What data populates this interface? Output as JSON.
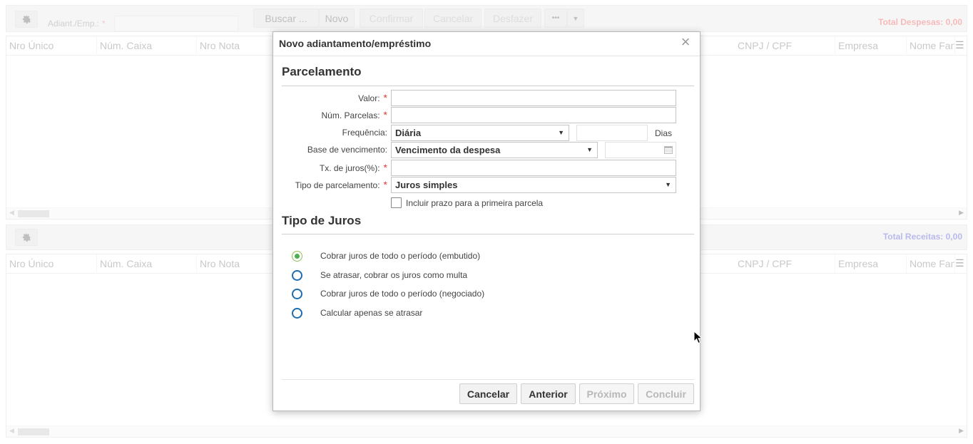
{
  "toolbar": {
    "field_label": "Adiant./Emp.:",
    "required_mark": "*",
    "buttons": {
      "buscar": "Buscar ...",
      "novo": "Novo",
      "confirmar": "Confirmar",
      "cancelar": "Cancelar",
      "desfazer": "Desfazer",
      "more": "•••"
    },
    "total_despesas": "Total Despesas: 0,00",
    "total_despesas_color": "#f08080"
  },
  "grid_columns": [
    "Nro Único",
    "Núm. Caixa",
    "Nro Nota",
    "CNPJ / CPF",
    "Empresa",
    "Nome Fant"
  ],
  "bar2": {
    "total_receitas": "Total Receitas: 0,00",
    "total_receitas_color": "#8080e0"
  },
  "modal": {
    "title": "Novo adiantamento/empréstimo",
    "section_parcelamento": "Parcelamento",
    "fields": {
      "valor": "Valor:",
      "num_parcelas": "Núm. Parcelas:",
      "frequencia": "Frequência:",
      "frequencia_value": "Diária",
      "dias_label": "Dias",
      "base_vencimento": "Base de vencimento:",
      "base_vencimento_value": "Vencimento da despesa",
      "tx_juros": "Tx. de juros(%):",
      "tipo_parcelamento": "Tipo de parcelamento:",
      "tipo_parcelamento_value": "Juros simples",
      "required_mark": "*"
    },
    "checkbox_label": "Incluir prazo para a primeira parcela",
    "section_tipo_juros": "Tipo de Juros",
    "radios": [
      {
        "label": "Cobrar juros de todo o período (embutido)",
        "selected": true
      },
      {
        "label": "Se atrasar, cobrar os juros como multa",
        "selected": false
      },
      {
        "label": "Cobrar juros de todo o período (negociado)",
        "selected": false
      },
      {
        "label": "Calcular apenas se atrasar",
        "selected": false
      }
    ],
    "footer": {
      "cancelar": "Cancelar",
      "anterior": "Anterior",
      "proximo": "Próximo",
      "concluir": "Concluir"
    }
  }
}
